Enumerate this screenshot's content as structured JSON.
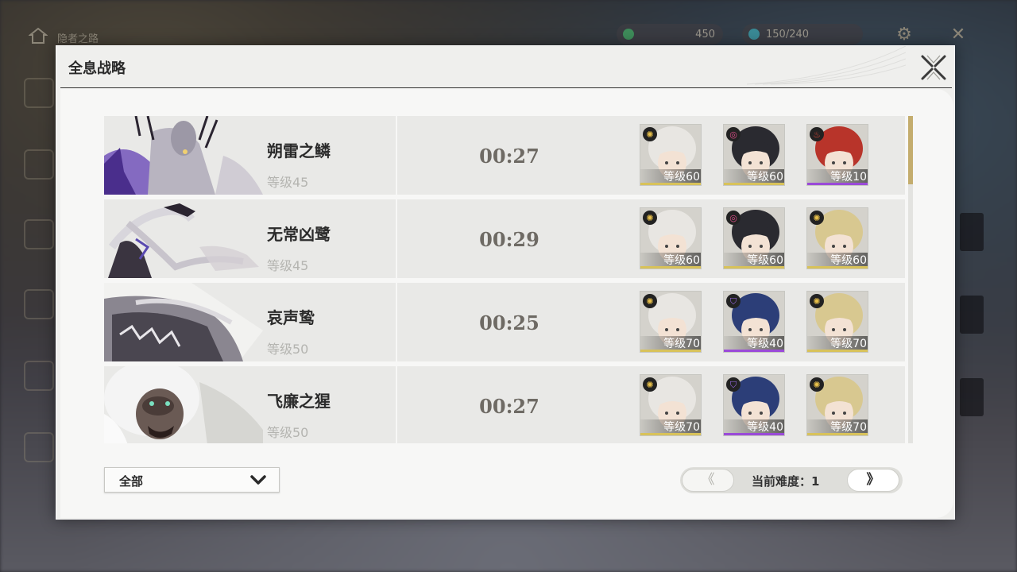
{
  "hud": {
    "title": "隐者之路",
    "resource1": "450",
    "resource2": "150/240"
  },
  "modal": {
    "title": "全息战略"
  },
  "bosses": [
    {
      "name": "朔雷之鳞",
      "level": "等级45",
      "time": "00:27",
      "team": [
        {
          "level": "等级60",
          "element": "sun-icon",
          "element_color": "#e8c04a",
          "rarity": "#d8c25a",
          "hair": "#e8e6e2"
        },
        {
          "level": "等级60",
          "element": "ring-icon",
          "element_color": "#e0508a",
          "rarity": "#d8c25a",
          "hair": "#2a2a30"
        },
        {
          "level": "等级10",
          "element": "flame-icon",
          "element_color": "#e84a3a",
          "rarity": "#9a4ad8",
          "hair": "#b8342a"
        }
      ]
    },
    {
      "name": "无常凶鹭",
      "level": "等级45",
      "time": "00:29",
      "team": [
        {
          "level": "等级60",
          "element": "sun-icon",
          "element_color": "#e8c04a",
          "rarity": "#d8c25a",
          "hair": "#e8e6e2"
        },
        {
          "level": "等级60",
          "element": "ring-icon",
          "element_color": "#e0508a",
          "rarity": "#d8c25a",
          "hair": "#2a2a30"
        },
        {
          "level": "等级60",
          "element": "sun-icon",
          "element_color": "#e8c04a",
          "rarity": "#d8c25a",
          "hair": "#d8c890"
        }
      ]
    },
    {
      "name": "哀声鸷",
      "level": "等级50",
      "time": "00:25",
      "team": [
        {
          "level": "等级70",
          "element": "sun-icon",
          "element_color": "#e8c04a",
          "rarity": "#d8c25a",
          "hair": "#e8e6e2"
        },
        {
          "level": "等级40",
          "element": "shield-icon",
          "element_color": "#9a6ae8",
          "rarity": "#9a4ad8",
          "hair": "#2c3e78"
        },
        {
          "level": "等级70",
          "element": "sun-icon",
          "element_color": "#e8c04a",
          "rarity": "#d8c25a",
          "hair": "#d8c890"
        }
      ]
    },
    {
      "name": "飞廉之猩",
      "level": "等级50",
      "time": "00:27",
      "team": [
        {
          "level": "等级70",
          "element": "sun-icon",
          "element_color": "#e8c04a",
          "rarity": "#d8c25a",
          "hair": "#e8e6e2"
        },
        {
          "level": "等级40",
          "element": "shield-icon",
          "element_color": "#9a6ae8",
          "rarity": "#9a4ad8",
          "hair": "#2c3e78"
        },
        {
          "level": "等级70",
          "element": "sun-icon",
          "element_color": "#e8c04a",
          "rarity": "#d8c25a",
          "hair": "#d8c890"
        }
      ]
    }
  ],
  "filter": {
    "selected": "全部"
  },
  "pager": {
    "prev": "《",
    "next": "》",
    "difficulty_label": "当前难度：",
    "difficulty_value": "1"
  },
  "colors": {
    "accent_gold": "#c4ad6e",
    "rarity_gold": "#d8c25a",
    "rarity_purple": "#9a4ad8"
  }
}
